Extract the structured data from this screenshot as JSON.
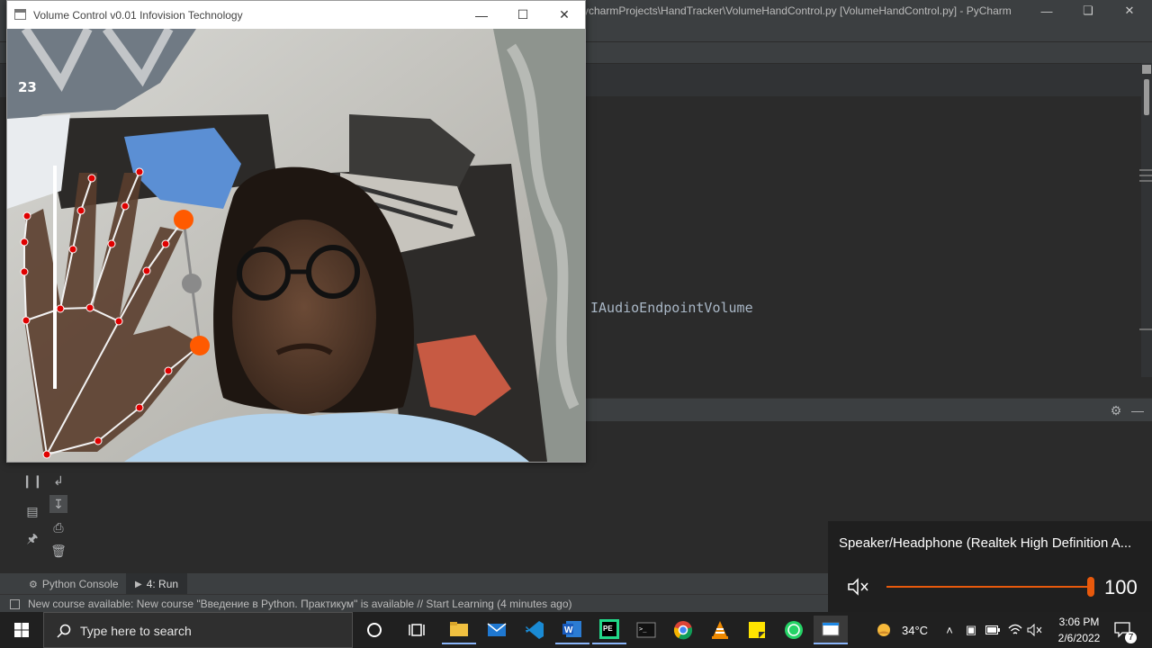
{
  "pycharm": {
    "title": "ycharmProjects\\HandTracker\\VolumeHandControl.py [VolumeHandControl.py] - PyCharm",
    "code_fragment": "IAudioEndpointVolume",
    "tabs": [
      {
        "label": "Python Console",
        "icon": "python-console-icon"
      },
      {
        "label": "4: Run",
        "icon": "run-icon"
      }
    ],
    "status_message": "New course available: New course \"Введение в Python. Практикум\" is available // Start Learning (4 minutes ago)"
  },
  "cv_window": {
    "title": "Volume Control v0.01  Infovision Technology",
    "fps": "23",
    "landmark_color": "#e00000",
    "active_tip_color": "#ff5a00",
    "midpoint_color": "#8a8a8a"
  },
  "volume_flyout": {
    "device": "Speaker/Headphone (Realtek High Definition A...",
    "value": "100",
    "level": 1.0,
    "accent_color": "#e8590c"
  },
  "taskbar": {
    "search_placeholder": "Type here to search",
    "pinned_apps": [
      "file-explorer-icon",
      "mail-icon",
      "vscode-icon",
      "word-icon",
      "pycharm-edu-icon",
      "terminal-icon",
      "chrome-icon",
      "vlc-icon",
      "sticky-notes-icon",
      "whatsapp-icon",
      "opencv-window-icon"
    ],
    "weather": "34°C",
    "time": "3:06 PM",
    "date": "2/6/2022",
    "notification_count": "7"
  }
}
